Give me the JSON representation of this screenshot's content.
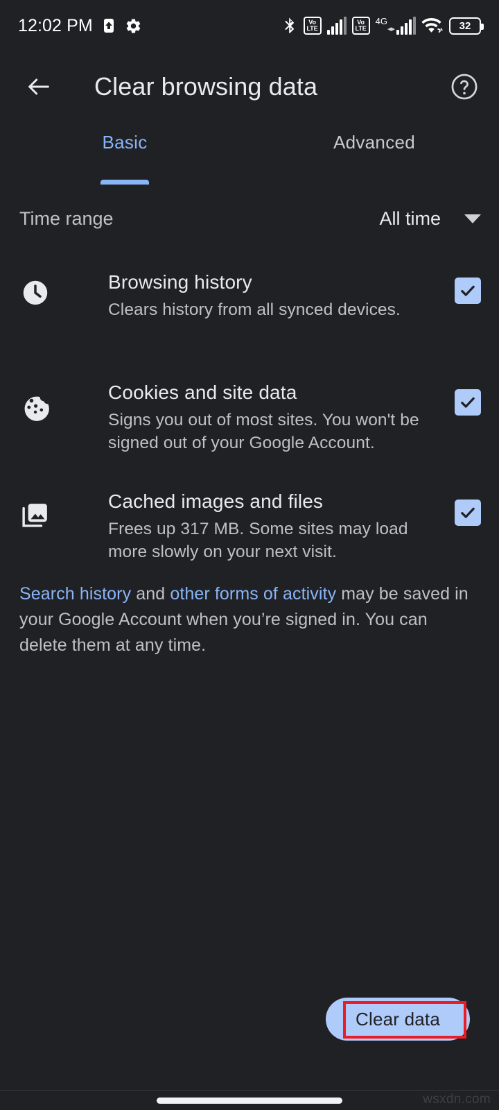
{
  "status_bar": {
    "time": "12:02 PM",
    "icons": [
      "upload-arrow-icon",
      "gear-icon",
      "bluetooth-icon"
    ],
    "sim1_volte": {
      "top": "Vo",
      "bottom": "LTE"
    },
    "sim2_volte": {
      "top": "Vo",
      "bottom": "LTE"
    },
    "network_type": "4G",
    "battery_level": "32"
  },
  "app_bar": {
    "back_label": "Back",
    "title": "Clear browsing data",
    "help_label": "Help"
  },
  "tabs": [
    {
      "label": "Basic",
      "active": true
    },
    {
      "label": "Advanced",
      "active": false
    }
  ],
  "time_range": {
    "label": "Time range",
    "value": "All time"
  },
  "options": [
    {
      "icon": "clock-icon",
      "title": "Browsing history",
      "description": "Clears history from all synced devices.",
      "checked": true
    },
    {
      "icon": "cookie-icon",
      "title": "Cookies and site data",
      "description": "Signs you out of most sites. You won't be signed out of your Google Account.",
      "checked": true
    },
    {
      "icon": "photo-library-icon",
      "title": "Cached images and files",
      "description": "Frees up 317 MB. Some sites may load more slowly on your next visit.",
      "checked": true
    }
  ],
  "footer_note": {
    "link1": "Search history",
    "mid": " and ",
    "link2": "other forms of activity",
    "tail": " may be saved in your Google Account when you’re signed in. You can delete them at any time."
  },
  "clear_button": {
    "label": "Clear data"
  },
  "watermark": "wsxdn.com",
  "colors": {
    "background": "#202124",
    "accent_blue": "#8ab4f8",
    "checkbox_blue": "#aecbfa",
    "primary_text": "#e8eaed",
    "secondary_text": "#bdc1c6",
    "highlight_red": "#ed1c24"
  }
}
